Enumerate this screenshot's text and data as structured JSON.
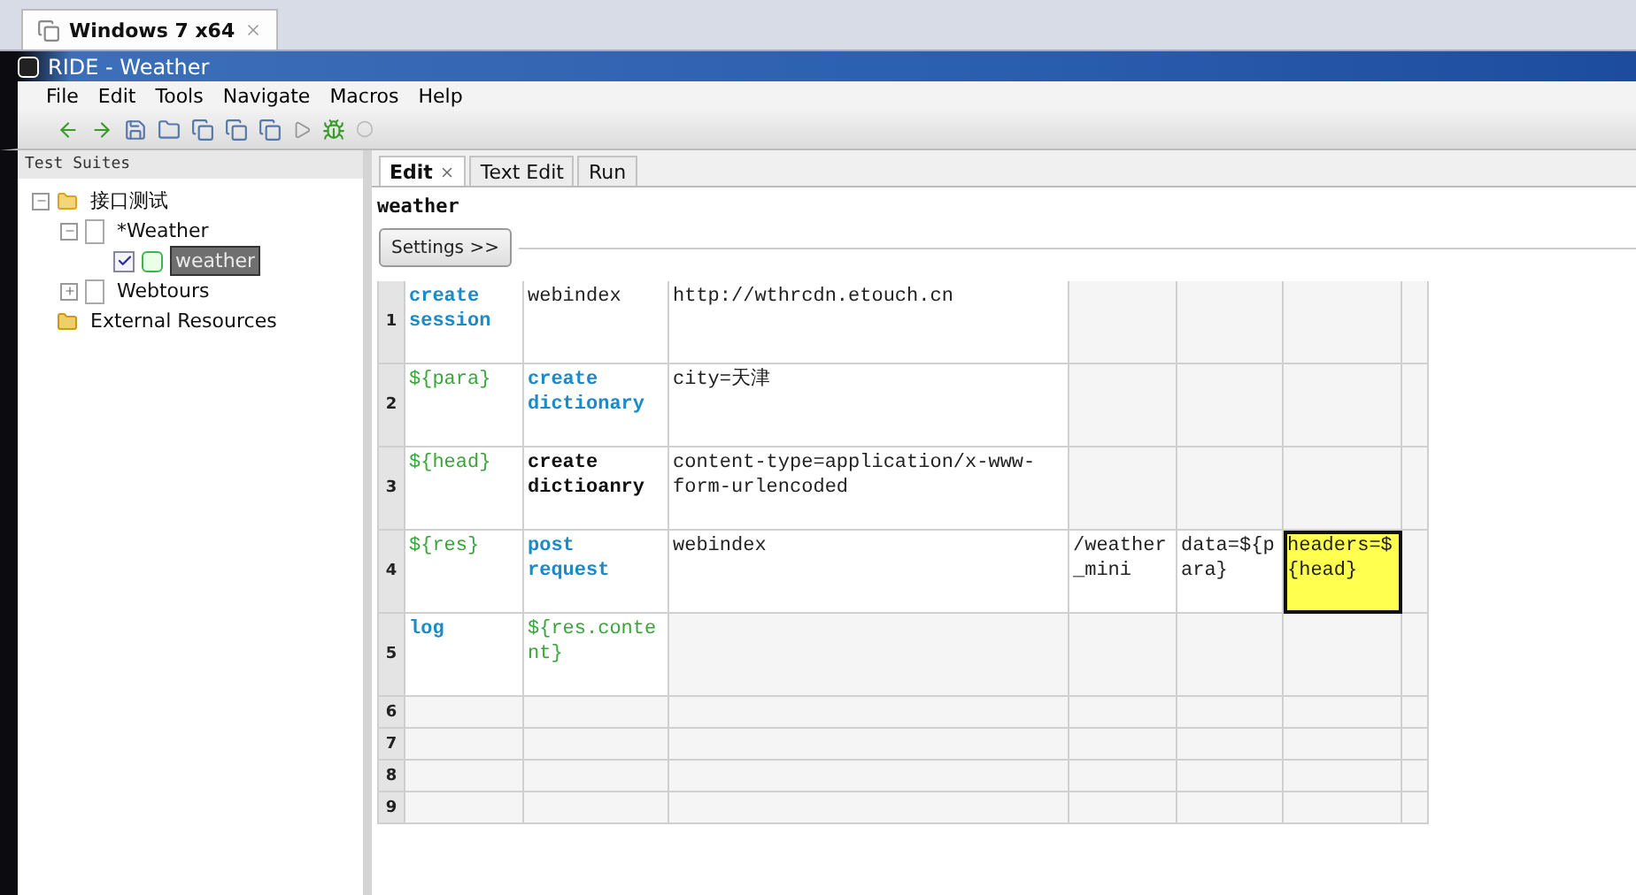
{
  "vm_tab": {
    "label": "Windows 7 x64"
  },
  "window": {
    "title": "RIDE - Weather"
  },
  "menu": [
    "File",
    "Edit",
    "Tools",
    "Navigate",
    "Macros",
    "Help"
  ],
  "tree": {
    "title": "Test Suites",
    "items": [
      {
        "label": "接口测试",
        "kind": "folder",
        "expanded": true,
        "children": [
          {
            "label": "*Weather",
            "kind": "suite",
            "expanded": true,
            "children": [
              {
                "label": "weather",
                "kind": "test",
                "checked": true,
                "selected": true
              }
            ]
          },
          {
            "label": "Webtours",
            "kind": "suite",
            "expanded": false
          }
        ]
      },
      {
        "label": "External Resources",
        "kind": "resources"
      }
    ]
  },
  "tabs": [
    {
      "label": "Edit",
      "selected": true
    },
    {
      "label": "Text Edit",
      "selected": false
    },
    {
      "label": "Run",
      "selected": false
    }
  ],
  "editor": {
    "name": "weather",
    "settings_button": "Settings >>",
    "rows": [
      {
        "number": "1",
        "cells": [
          {
            "text": "create session",
            "kind": "keyword"
          },
          {
            "text": "webindex",
            "kind": "arg"
          },
          {
            "text": "http://wthrcdn.etouch.cn",
            "kind": "arg"
          }
        ]
      },
      {
        "number": "2",
        "cells": [
          {
            "text": "${para}",
            "kind": "variable"
          },
          {
            "text": "create dictionary",
            "kind": "keyword"
          },
          {
            "text": "city=天津",
            "kind": "arg"
          }
        ]
      },
      {
        "number": "3",
        "cells": [
          {
            "text": "${head}",
            "kind": "variable"
          },
          {
            "text": "create dictioanry",
            "kind": "unknown"
          },
          {
            "text": "content-type=application/x-www-form-urlencoded",
            "kind": "arg"
          }
        ]
      },
      {
        "number": "4",
        "cells": [
          {
            "text": "${res}",
            "kind": "variable"
          },
          {
            "text": "post request",
            "kind": "keyword"
          },
          {
            "text": "webindex",
            "kind": "arg"
          },
          {
            "text": "/weather_mini",
            "kind": "arg"
          },
          {
            "text": "data=${para}",
            "kind": "arg"
          },
          {
            "text": "headers=${head}",
            "kind": "arg",
            "selected": true
          }
        ]
      },
      {
        "number": "5",
        "cells": [
          {
            "text": "log",
            "kind": "keyword"
          },
          {
            "text": "${res.content}",
            "kind": "variable"
          }
        ]
      },
      {
        "number": "6",
        "cells": []
      },
      {
        "number": "7",
        "cells": []
      },
      {
        "number": "8",
        "cells": []
      },
      {
        "number": "9",
        "cells": []
      }
    ]
  }
}
